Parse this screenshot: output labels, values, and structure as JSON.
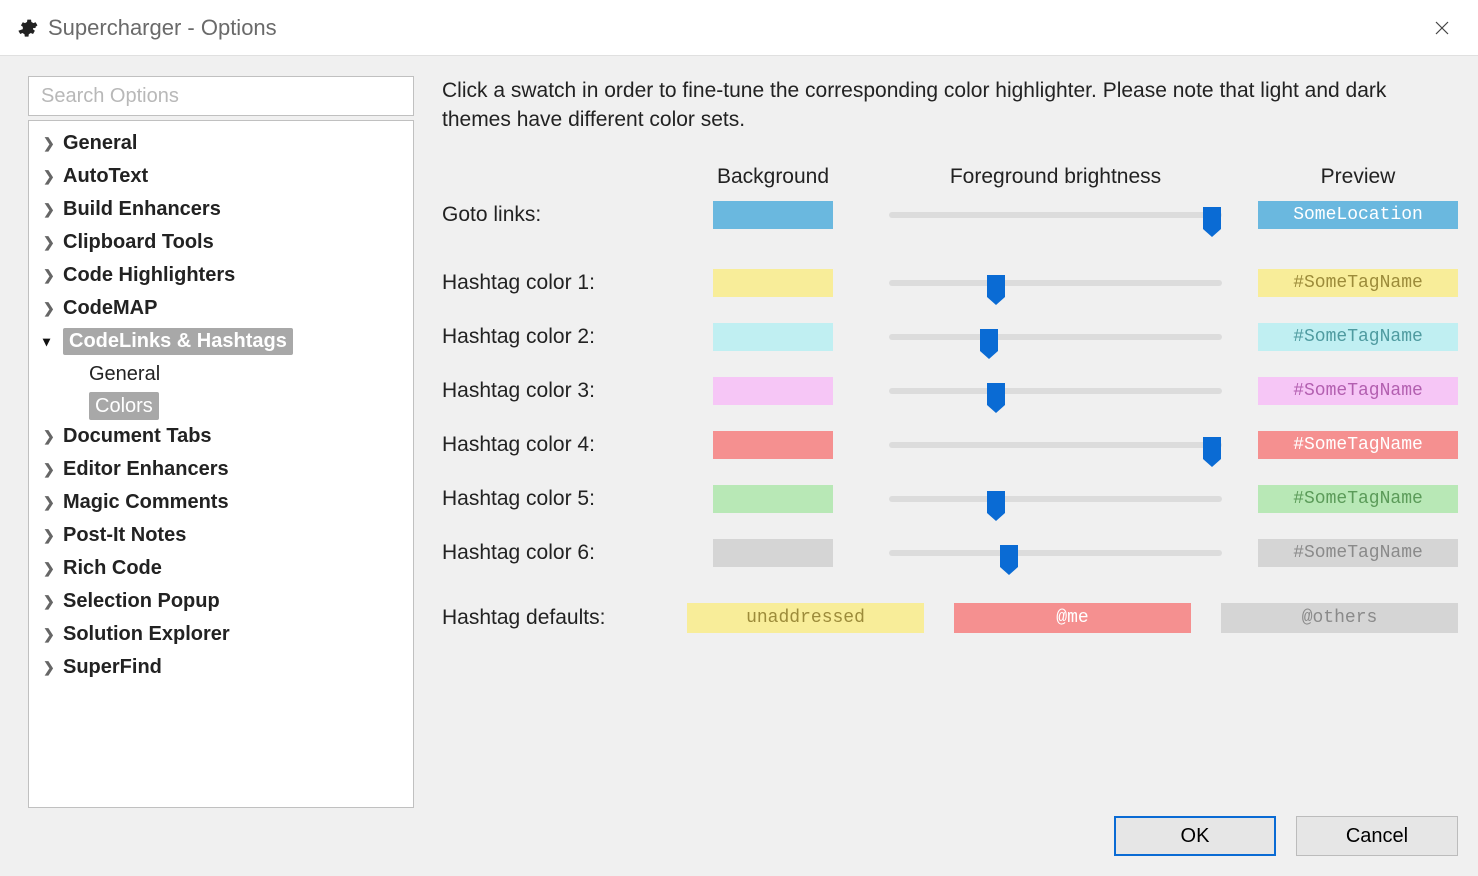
{
  "window_title": "Supercharger - Options",
  "search_placeholder": "Search Options",
  "tree": [
    {
      "label": "General",
      "expanded": false
    },
    {
      "label": "AutoText",
      "expanded": false
    },
    {
      "label": "Build Enhancers",
      "expanded": false
    },
    {
      "label": "Clipboard Tools",
      "expanded": false
    },
    {
      "label": "Code Highlighters",
      "expanded": false
    },
    {
      "label": "CodeMAP",
      "expanded": false
    },
    {
      "label": "CodeLinks & Hashtags",
      "expanded": true,
      "selected": true,
      "children": [
        {
          "label": "General",
          "selected": false
        },
        {
          "label": "Colors",
          "selected": true
        }
      ]
    },
    {
      "label": "Document Tabs",
      "expanded": false
    },
    {
      "label": "Editor Enhancers",
      "expanded": false
    },
    {
      "label": "Magic Comments",
      "expanded": false
    },
    {
      "label": "Post-It Notes",
      "expanded": false
    },
    {
      "label": "Rich Code",
      "expanded": false
    },
    {
      "label": "Selection Popup",
      "expanded": false
    },
    {
      "label": "Solution Explorer",
      "expanded": false
    },
    {
      "label": "SuperFind",
      "expanded": false
    }
  ],
  "description": "Click a swatch in order to fine-tune the corresponding color highlighter. Please note that light and dark themes have different color sets.",
  "headers": {
    "bg": "Background",
    "fg": "Foreground brightness",
    "preview": "Preview"
  },
  "rows": [
    {
      "label": "Goto links:",
      "bg": "#6ab8df",
      "slider": 97,
      "preview_text": "SomeLocation",
      "preview_bg": "#6ab8df",
      "preview_fg": "#ffffff"
    },
    {
      "label": "Hashtag color 1:",
      "bg": "#f8ed99",
      "slider": 32,
      "preview_text": "#SomeTagName",
      "preview_bg": "#f8ed99",
      "preview_fg": "#9c8b3a"
    },
    {
      "label": "Hashtag color 2:",
      "bg": "#c0eff2",
      "slider": 30,
      "preview_text": "#SomeTagName",
      "preview_bg": "#c0eff2",
      "preview_fg": "#4f9ba0"
    },
    {
      "label": "Hashtag color 3:",
      "bg": "#f6c6f6",
      "slider": 32,
      "preview_text": "#SomeTagName",
      "preview_bg": "#f6c6f6",
      "preview_fg": "#b35fb0"
    },
    {
      "label": "Hashtag color 4:",
      "bg": "#f59090",
      "slider": 97,
      "preview_text": "#SomeTagName",
      "preview_bg": "#f59090",
      "preview_fg": "#ffffff"
    },
    {
      "label": "Hashtag color 5:",
      "bg": "#b8e8b6",
      "slider": 32,
      "preview_text": "#SomeTagName",
      "preview_bg": "#b8e8b6",
      "preview_fg": "#5b9b59"
    },
    {
      "label": "Hashtag color 6:",
      "bg": "#d5d5d5",
      "slider": 36,
      "preview_text": "#SomeTagName",
      "preview_bg": "#d5d5d5",
      "preview_fg": "#8a8a8a"
    }
  ],
  "defaults": {
    "label": "Hashtag defaults:",
    "items": [
      {
        "text": "unaddressed",
        "bg": "#f8ed99",
        "fg": "#9c8b3a"
      },
      {
        "text": "@me",
        "bg": "#f59090",
        "fg": "#ffffff"
      },
      {
        "text": "@others",
        "bg": "#d5d5d5",
        "fg": "#8a8a8a"
      }
    ]
  },
  "buttons": {
    "ok": "OK",
    "cancel": "Cancel"
  }
}
